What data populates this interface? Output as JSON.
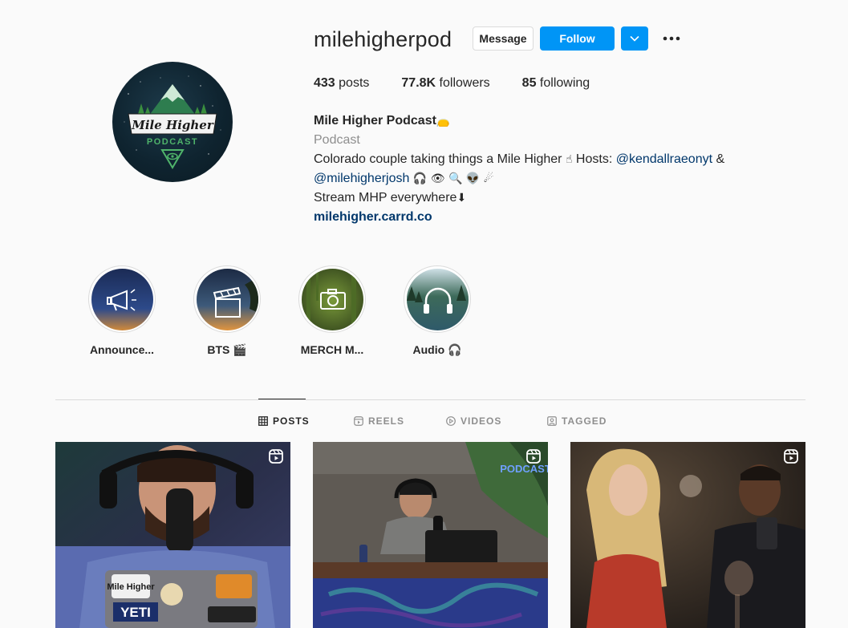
{
  "profile": {
    "username": "milehigherpod",
    "message_label": "Message",
    "follow_label": "Follow",
    "avatar_text_1": "Mile Higher",
    "avatar_text_2": "PODCAST",
    "stats": {
      "posts_count": "433",
      "posts_label": " posts",
      "followers_count": "77.8K",
      "followers_label": " followers",
      "following_count": "85",
      "following_label": " following"
    },
    "bio": {
      "name": "Mile Higher Podcast",
      "name_emoji": "👝",
      "category": "Podcast",
      "line1_text": "Colorado couple taking things a Mile Higher ",
      "line1_emoji": "☝",
      "line1_hosts": " Hosts: ",
      "mention1": "@kendallraeonyt",
      "amp": " &",
      "mention2": "@milehigherjosh",
      "line2_emojis": " 🎧 👁 🔍 👽 ☄",
      "line3_text": "Stream MHP everywhere",
      "line3_emoji": "⬇",
      "link": "milehigher.carrd.co"
    }
  },
  "highlights": [
    {
      "label": "Announce...",
      "icon": "megaphone-icon"
    },
    {
      "label": "BTS 🎬",
      "icon": "clapperboard-icon"
    },
    {
      "label": "MERCH M...",
      "icon": "camera-icon"
    },
    {
      "label": "Audio 🎧",
      "icon": "headphones-icon"
    }
  ],
  "tabs": [
    {
      "label": "POSTS",
      "icon": "grid-icon",
      "active": true
    },
    {
      "label": "REELS",
      "icon": "reels-icon",
      "active": false
    },
    {
      "label": "VIDEOS",
      "icon": "play-icon",
      "active": false
    },
    {
      "label": "TAGGED",
      "icon": "tag-icon",
      "active": false
    }
  ],
  "posts": [
    {
      "type": "reel",
      "sticker_text": "YETI"
    },
    {
      "type": "reel",
      "sticker_text": "PODCAST"
    },
    {
      "type": "reel",
      "sticker_text": ""
    }
  ],
  "colors": {
    "accent": "#0095f6",
    "link": "#00376b",
    "secondary_text": "#8e8e8e",
    "border": "#dbdbdb"
  }
}
